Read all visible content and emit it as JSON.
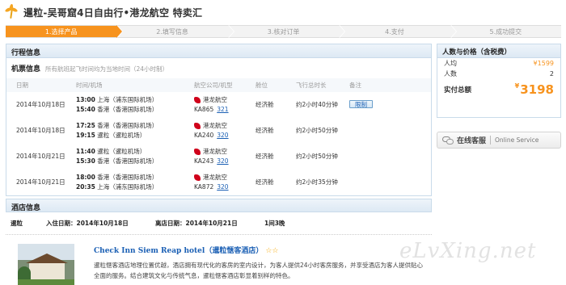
{
  "header": {
    "title": "暹粒-吴哥窟4日自由行•港龙航空 特卖汇"
  },
  "steps": [
    "1.选择产品",
    "2.填写信息",
    "3.核对订单",
    "4.支付",
    "5.成功提交"
  ],
  "itinerary": {
    "section_title": "行程信息",
    "sub_title": "机票信息",
    "sub_note": "所有航班起飞时间均为当地时间（24小时制）",
    "columns": [
      "日期",
      "时间/机场",
      "航空公司/机型",
      "舱位",
      "飞行总时长",
      "备注"
    ],
    "flights": [
      {
        "date": "2014年10月18日",
        "dep_time": "13:00",
        "dep_place": "上海（浦东国际机场）",
        "arr_time": "15:40",
        "arr_place": "香港（香港国际机场）",
        "airline": "港龙航空",
        "flight_no": "KA865",
        "aircraft": "321",
        "cabin": "经济舱",
        "duration": "约2小时40分钟",
        "note": "限制"
      },
      {
        "date": "2014年10月18日",
        "dep_time": "17:25",
        "dep_place": "香港（香港国际机场）",
        "arr_time": "19:15",
        "arr_place": "暹粒（暹粒机场）",
        "airline": "港龙航空",
        "flight_no": "KA240",
        "aircraft": "320",
        "cabin": "经济舱",
        "duration": "约2小时50分钟",
        "note": ""
      },
      {
        "date": "2014年10月21日",
        "dep_time": "11:40",
        "dep_place": "暹粒（暹粒机场）",
        "arr_time": "15:30",
        "arr_place": "香港（香港国际机场）",
        "airline": "港龙航空",
        "flight_no": "KA243",
        "aircraft": "320",
        "cabin": "经济舱",
        "duration": "约2小时50分钟",
        "note": ""
      },
      {
        "date": "2014年10月21日",
        "dep_time": "18:00",
        "dep_place": "香港（香港国际机场）",
        "arr_time": "20:35",
        "arr_place": "上海（浦东国际机场）",
        "airline": "港龙航空",
        "flight_no": "KA872",
        "aircraft": "320",
        "cabin": "经济舱",
        "duration": "约2小时35分钟",
        "note": ""
      }
    ]
  },
  "pricing": {
    "title": "人数与价格（含税费）",
    "per_person_label": "人均",
    "per_person_value": "¥1599",
    "people_label": "人数",
    "people_value": "2",
    "total_label": "实付总额",
    "currency": "¥",
    "total_value": "3198"
  },
  "service": {
    "label_cn": "在线客服",
    "label_en": "Online Service"
  },
  "hotel": {
    "section_title": "酒店信息",
    "city": "暹粒",
    "checkin": "入住日期：2014年10月18日",
    "checkout": "离店日期：2014年10月21日",
    "nights": "1间3晚",
    "name": "Check Inn Siem Reap hotel（暹粒惬客酒店）",
    "stars": "☆☆",
    "description": "暹粒惬客酒店地理位置优越，酒店拥有现代化的客房的室内设计，为客人提供24小时客房服务，并享受酒店为客人提供贴心全面的服务。结合建筑文化与传统气息，暹粒惬客酒店彰显着别样的特色。"
  },
  "watermark": "eLvXing.net"
}
